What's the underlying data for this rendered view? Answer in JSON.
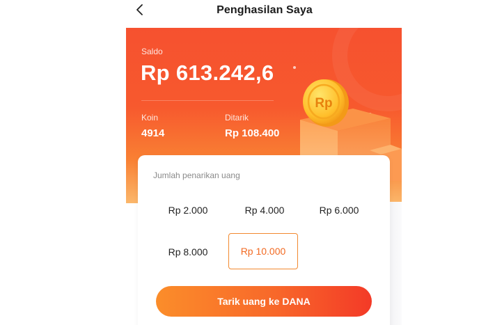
{
  "header": {
    "title": "Penghasilan Saya",
    "back_icon": "chevron-left-icon"
  },
  "balance": {
    "saldo_label": "Saldo",
    "saldo_value": "Rp 613.242,6",
    "koin_label": "Koin",
    "koin_value": "4914",
    "ditarik_label": "Ditarik",
    "ditarik_value": "Rp 108.400",
    "coin_symbol": "Rp"
  },
  "withdraw": {
    "label": "Jumlah penarikan uang",
    "options": [
      {
        "label": "Rp 2.000",
        "selected": false
      },
      {
        "label": "Rp 4.000",
        "selected": false
      },
      {
        "label": "Rp 6.000",
        "selected": false
      },
      {
        "label": "Rp 8.000",
        "selected": false
      },
      {
        "label": "Rp 10.000",
        "selected": true
      }
    ],
    "button_label": "Tarik uang ke DANA"
  },
  "colors": {
    "accent": "#f6512f",
    "selected_border": "#f2892f",
    "button_start": "#fb8d2a",
    "button_end": "#f33a27"
  }
}
